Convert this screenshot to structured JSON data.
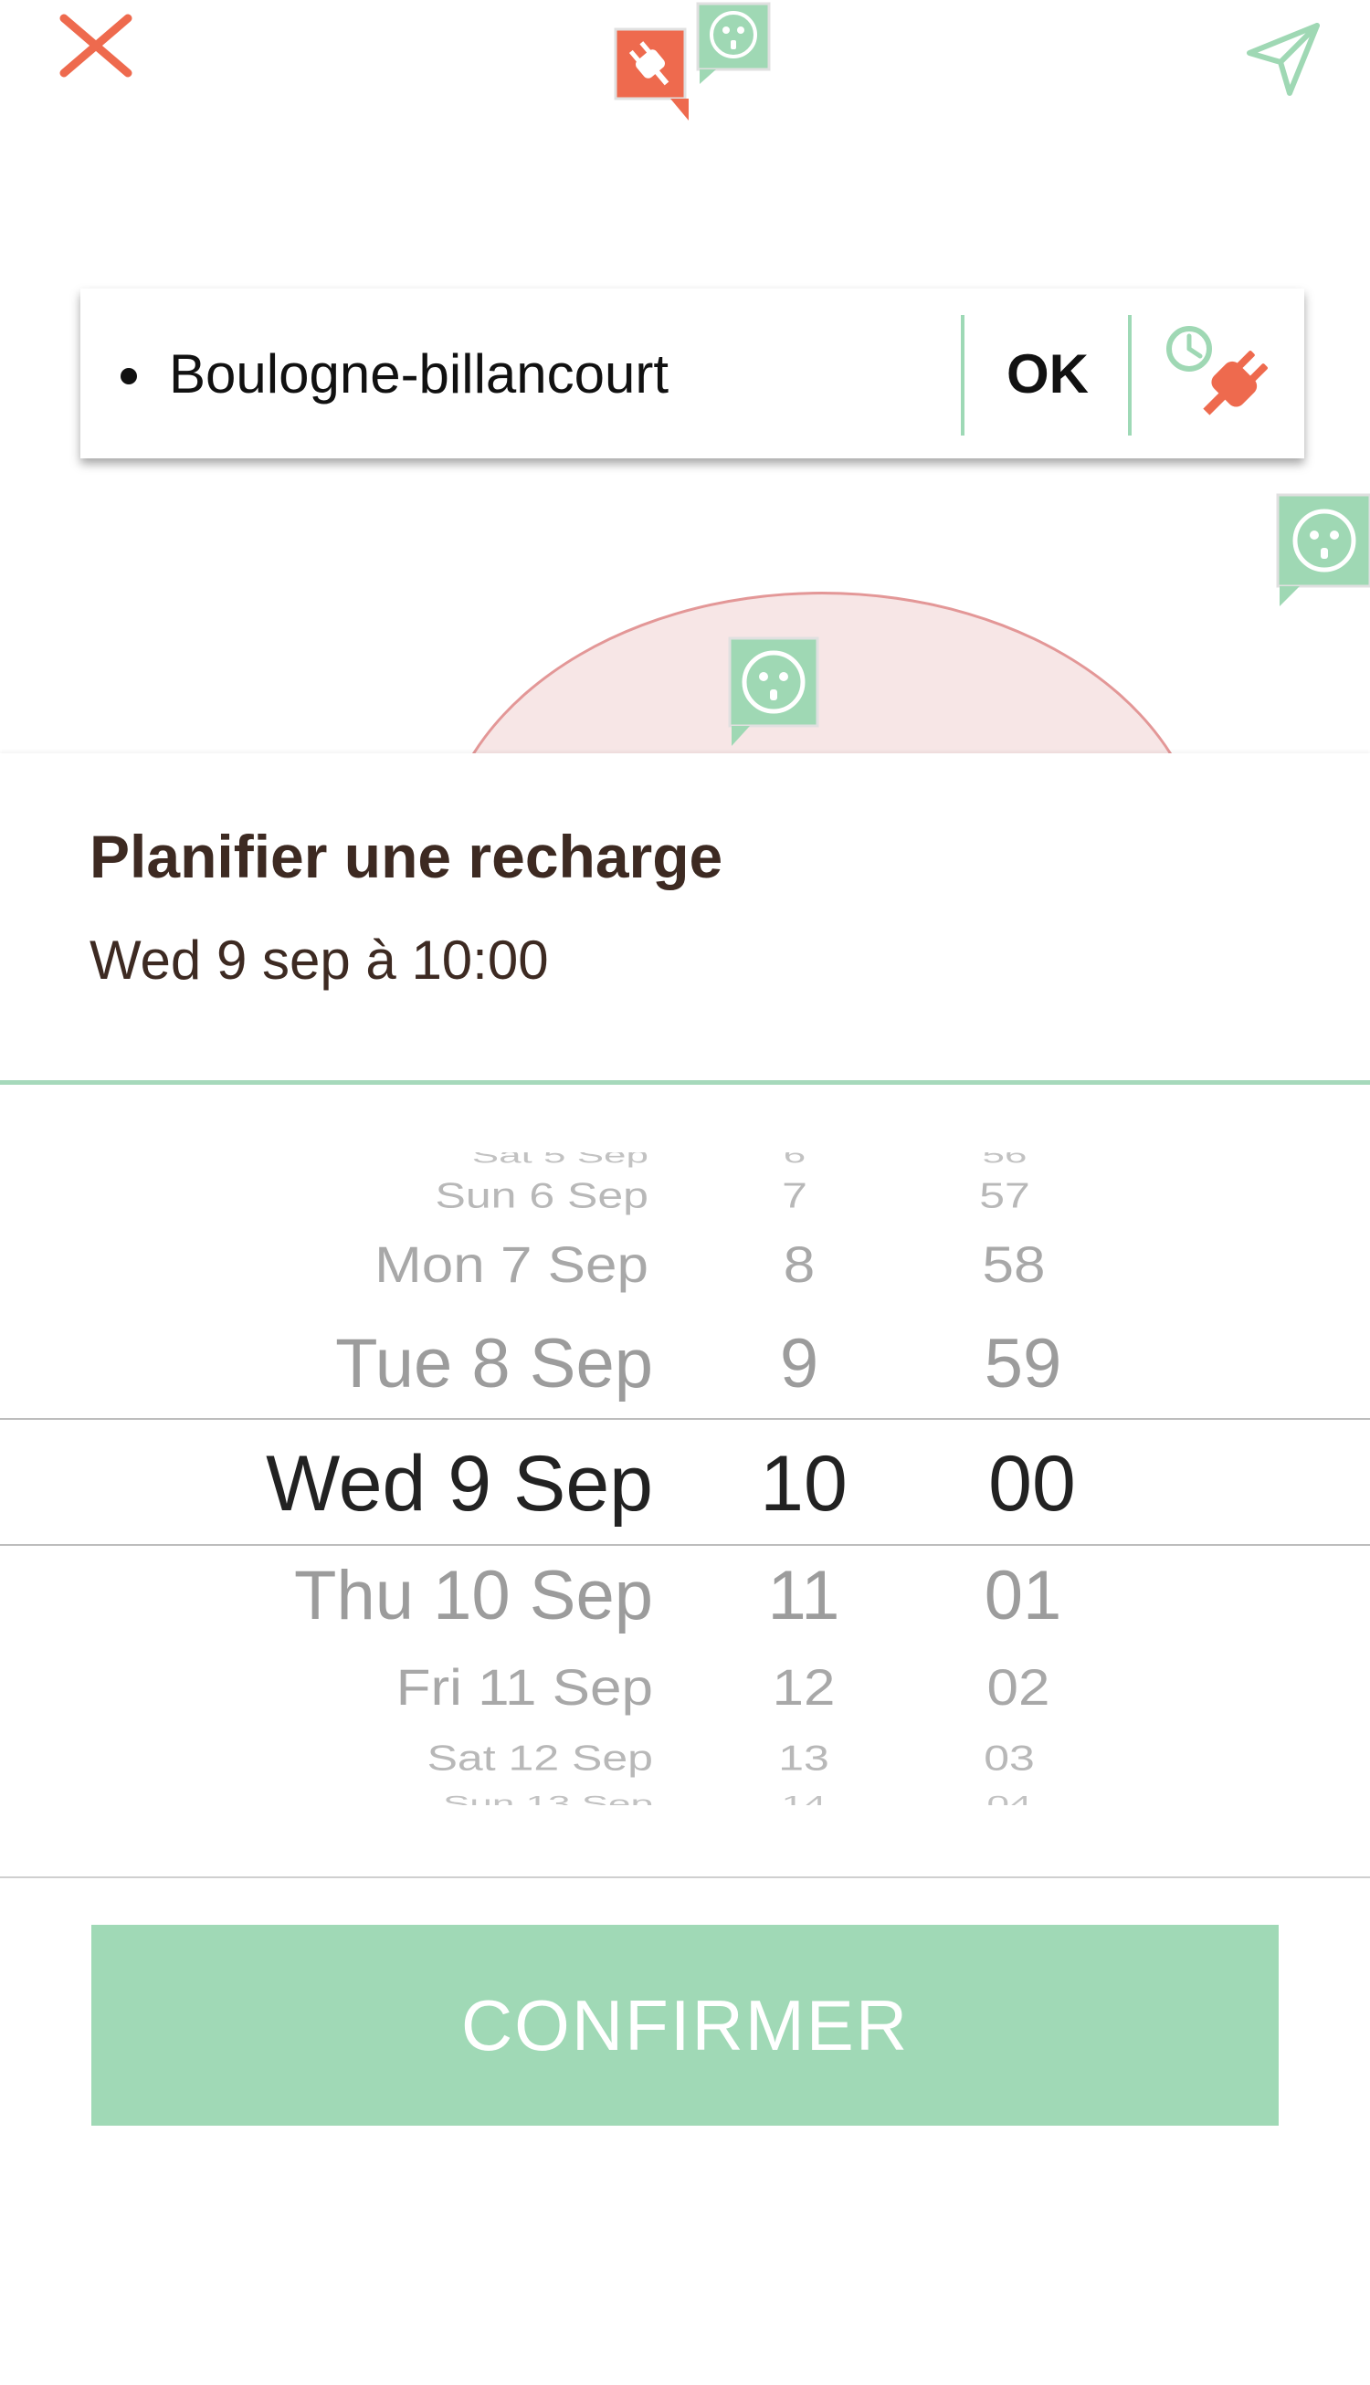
{
  "header": {
    "close_icon": "close-x-icon",
    "send_icon": "send-paper-plane-icon",
    "accent_red": "#ee6a4e",
    "accent_green": "#a0d9b6"
  },
  "search": {
    "location": "Boulogne-billancourt",
    "ok_label": "OK",
    "schedule_icon": "clock-plug-icon"
  },
  "map": {
    "markers": [
      "plug-busy-marker-icon",
      "socket-available-marker-icon"
    ]
  },
  "sheet": {
    "title": "Planifier une recharge",
    "subtitle": "Wed 9 sep à 10:00"
  },
  "picker": {
    "days": [
      "Sat 5 Sep",
      "Sun 6 Sep",
      "Mon 7 Sep",
      "Tue 8 Sep",
      "Wed 9 Sep",
      "Thu 10 Sep",
      "Fri 11 Sep",
      "Sat 12 Sep",
      "Sun 13 Sep"
    ],
    "hours": [
      "6",
      "7",
      "8",
      "9",
      "10",
      "11",
      "12",
      "13",
      "14"
    ],
    "minutes": [
      "56",
      "57",
      "58",
      "59",
      "00",
      "01",
      "02",
      "03",
      "04"
    ],
    "selected": {
      "day": "Wed 9 Sep",
      "hour": "10",
      "minute": "00"
    }
  },
  "confirm_label": "CONFIRMER"
}
